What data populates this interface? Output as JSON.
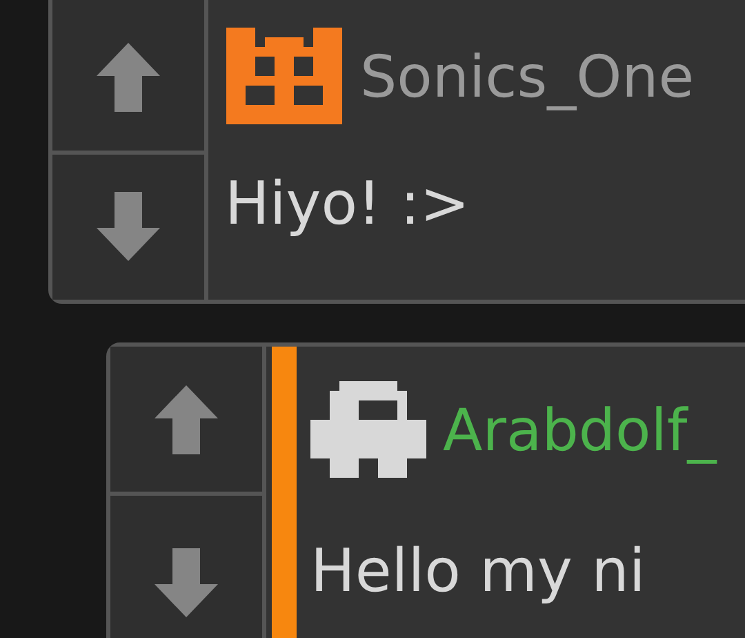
{
  "comments": [
    {
      "username": "Sonics_One",
      "color": "#9a9a9a",
      "message": "Hiyo! :>",
      "avatar": {
        "kind": "cat",
        "color": "#f47a1f"
      },
      "highlighted": false
    },
    {
      "username": "Arabdolf_",
      "color": "#4cb34c",
      "message": "Hello my ni",
      "avatar": {
        "kind": "blob",
        "color": "#d8d8d8"
      },
      "highlighted": true
    }
  ]
}
